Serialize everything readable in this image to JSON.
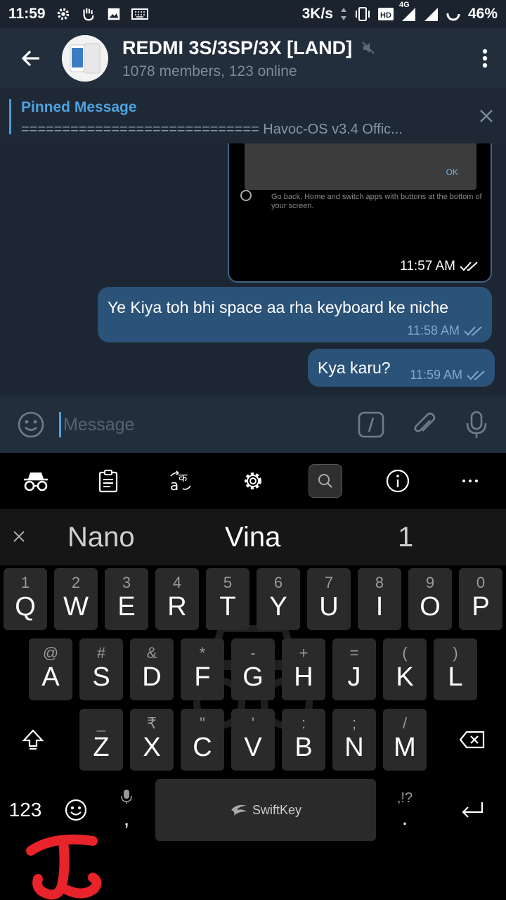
{
  "status": {
    "time": "11:59",
    "speed": "3K/s",
    "net": "4G",
    "battery": "46%"
  },
  "header": {
    "title": "REDMI 3S/3SP/3X [LAND]",
    "subtitle": "1078 members, 123 online"
  },
  "pinned": {
    "title": "Pinned Message",
    "text": "=============================     Havoc-OS v3.4 Offic..."
  },
  "image_message": {
    "dialog_ok": "OK",
    "description": "Go back, Home and switch apps with buttons at the bottom of your screen.",
    "time": "11:57 AM"
  },
  "messages": [
    {
      "text": "Ye Kiya toh bhi space aa rha keyboard ke niche",
      "time": "11:58 AM"
    },
    {
      "text": "Kya karu?",
      "time": "11:59 AM"
    }
  ],
  "input": {
    "placeholder": "Message"
  },
  "suggestions": [
    "Nano",
    "Vina",
    "1"
  ],
  "keyboard": {
    "row1": [
      [
        "1",
        "Q"
      ],
      [
        "2",
        "W"
      ],
      [
        "3",
        "E"
      ],
      [
        "4",
        "R"
      ],
      [
        "5",
        "T"
      ],
      [
        "6",
        "Y"
      ],
      [
        "7",
        "U"
      ],
      [
        "8",
        "I"
      ],
      [
        "9",
        "O"
      ],
      [
        "0",
        "P"
      ]
    ],
    "row2": [
      [
        "@",
        "A"
      ],
      [
        "#",
        "S"
      ],
      [
        "&",
        "D"
      ],
      [
        "*",
        "F"
      ],
      [
        "-",
        "G"
      ],
      [
        "+",
        "H"
      ],
      [
        "=",
        "J"
      ],
      [
        "(",
        "K"
      ],
      [
        ")",
        "L"
      ]
    ],
    "row3": [
      [
        "_",
        "Z"
      ],
      [
        "₹",
        "X"
      ],
      [
        "\"",
        "C"
      ],
      [
        "'",
        "V"
      ],
      [
        ":",
        "B"
      ],
      [
        ";",
        "N"
      ],
      [
        "/",
        "M"
      ]
    ],
    "num_label": "123",
    "space_label": "SwiftKey",
    "comma": ",",
    "period": ".",
    "period_hint": ",!?"
  },
  "colors": {
    "accent": "#4da3e0",
    "bubble": "#2b5278",
    "background": "#1d2733"
  }
}
